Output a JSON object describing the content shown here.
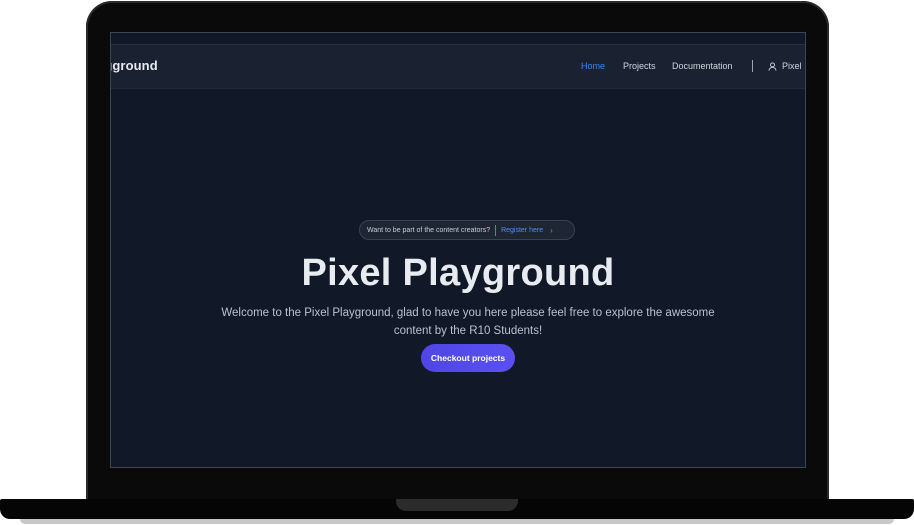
{
  "navbar": {
    "brand": "ygground",
    "links": [
      {
        "label": "Home",
        "active": true
      },
      {
        "label": "Projects",
        "active": false
      },
      {
        "label": "Documentation",
        "active": false
      }
    ],
    "user_label": "Pixel",
    "user_icon": "user-icon"
  },
  "banner": {
    "text": "Want to be part of the content creators?",
    "link": "Register here",
    "chevron_icon": "chevron-right-icon"
  },
  "hero": {
    "title": "Pixel Playground",
    "subtitle": "Welcome to the Pixel Playground, glad to have you here please feel free to explore the awesome content by the R10 Students!",
    "cta_label": "Checkout projects"
  },
  "colors": {
    "background": "#111827",
    "navbar": "#1a2231",
    "accent": "#3b82f6",
    "button": "#4f46e5"
  }
}
